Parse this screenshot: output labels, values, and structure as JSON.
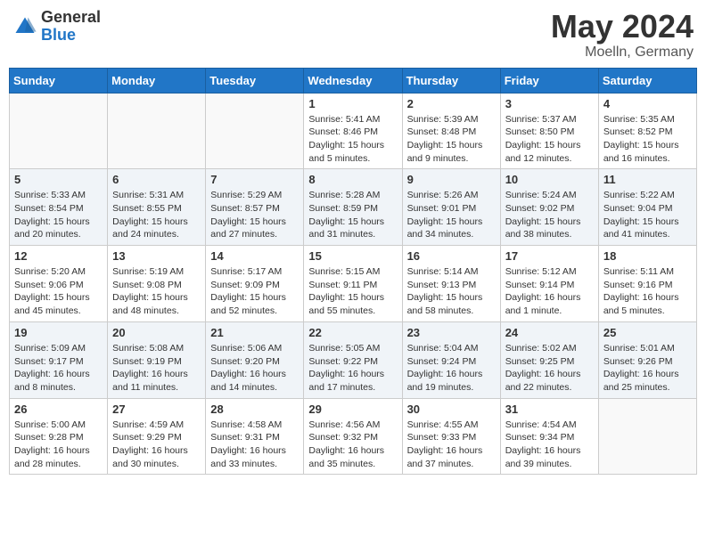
{
  "header": {
    "logo_general": "General",
    "logo_blue": "Blue",
    "title": "May 2024",
    "location": "Moelln, Germany"
  },
  "weekdays": [
    "Sunday",
    "Monday",
    "Tuesday",
    "Wednesday",
    "Thursday",
    "Friday",
    "Saturday"
  ],
  "weeks": [
    {
      "rowClass": "row-white",
      "days": [
        {
          "num": "",
          "info": "",
          "empty": true
        },
        {
          "num": "",
          "info": "",
          "empty": true
        },
        {
          "num": "",
          "info": "",
          "empty": true
        },
        {
          "num": "1",
          "info": "Sunrise: 5:41 AM\nSunset: 8:46 PM\nDaylight: 15 hours\nand 5 minutes.",
          "empty": false
        },
        {
          "num": "2",
          "info": "Sunrise: 5:39 AM\nSunset: 8:48 PM\nDaylight: 15 hours\nand 9 minutes.",
          "empty": false
        },
        {
          "num": "3",
          "info": "Sunrise: 5:37 AM\nSunset: 8:50 PM\nDaylight: 15 hours\nand 12 minutes.",
          "empty": false
        },
        {
          "num": "4",
          "info": "Sunrise: 5:35 AM\nSunset: 8:52 PM\nDaylight: 15 hours\nand 16 minutes.",
          "empty": false
        }
      ]
    },
    {
      "rowClass": "row-alt",
      "days": [
        {
          "num": "5",
          "info": "Sunrise: 5:33 AM\nSunset: 8:54 PM\nDaylight: 15 hours\nand 20 minutes.",
          "empty": false
        },
        {
          "num": "6",
          "info": "Sunrise: 5:31 AM\nSunset: 8:55 PM\nDaylight: 15 hours\nand 24 minutes.",
          "empty": false
        },
        {
          "num": "7",
          "info": "Sunrise: 5:29 AM\nSunset: 8:57 PM\nDaylight: 15 hours\nand 27 minutes.",
          "empty": false
        },
        {
          "num": "8",
          "info": "Sunrise: 5:28 AM\nSunset: 8:59 PM\nDaylight: 15 hours\nand 31 minutes.",
          "empty": false
        },
        {
          "num": "9",
          "info": "Sunrise: 5:26 AM\nSunset: 9:01 PM\nDaylight: 15 hours\nand 34 minutes.",
          "empty": false
        },
        {
          "num": "10",
          "info": "Sunrise: 5:24 AM\nSunset: 9:02 PM\nDaylight: 15 hours\nand 38 minutes.",
          "empty": false
        },
        {
          "num": "11",
          "info": "Sunrise: 5:22 AM\nSunset: 9:04 PM\nDaylight: 15 hours\nand 41 minutes.",
          "empty": false
        }
      ]
    },
    {
      "rowClass": "row-white",
      "days": [
        {
          "num": "12",
          "info": "Sunrise: 5:20 AM\nSunset: 9:06 PM\nDaylight: 15 hours\nand 45 minutes.",
          "empty": false
        },
        {
          "num": "13",
          "info": "Sunrise: 5:19 AM\nSunset: 9:08 PM\nDaylight: 15 hours\nand 48 minutes.",
          "empty": false
        },
        {
          "num": "14",
          "info": "Sunrise: 5:17 AM\nSunset: 9:09 PM\nDaylight: 15 hours\nand 52 minutes.",
          "empty": false
        },
        {
          "num": "15",
          "info": "Sunrise: 5:15 AM\nSunset: 9:11 PM\nDaylight: 15 hours\nand 55 minutes.",
          "empty": false
        },
        {
          "num": "16",
          "info": "Sunrise: 5:14 AM\nSunset: 9:13 PM\nDaylight: 15 hours\nand 58 minutes.",
          "empty": false
        },
        {
          "num": "17",
          "info": "Sunrise: 5:12 AM\nSunset: 9:14 PM\nDaylight: 16 hours\nand 1 minute.",
          "empty": false
        },
        {
          "num": "18",
          "info": "Sunrise: 5:11 AM\nSunset: 9:16 PM\nDaylight: 16 hours\nand 5 minutes.",
          "empty": false
        }
      ]
    },
    {
      "rowClass": "row-alt",
      "days": [
        {
          "num": "19",
          "info": "Sunrise: 5:09 AM\nSunset: 9:17 PM\nDaylight: 16 hours\nand 8 minutes.",
          "empty": false
        },
        {
          "num": "20",
          "info": "Sunrise: 5:08 AM\nSunset: 9:19 PM\nDaylight: 16 hours\nand 11 minutes.",
          "empty": false
        },
        {
          "num": "21",
          "info": "Sunrise: 5:06 AM\nSunset: 9:20 PM\nDaylight: 16 hours\nand 14 minutes.",
          "empty": false
        },
        {
          "num": "22",
          "info": "Sunrise: 5:05 AM\nSunset: 9:22 PM\nDaylight: 16 hours\nand 17 minutes.",
          "empty": false
        },
        {
          "num": "23",
          "info": "Sunrise: 5:04 AM\nSunset: 9:24 PM\nDaylight: 16 hours\nand 19 minutes.",
          "empty": false
        },
        {
          "num": "24",
          "info": "Sunrise: 5:02 AM\nSunset: 9:25 PM\nDaylight: 16 hours\nand 22 minutes.",
          "empty": false
        },
        {
          "num": "25",
          "info": "Sunrise: 5:01 AM\nSunset: 9:26 PM\nDaylight: 16 hours\nand 25 minutes.",
          "empty": false
        }
      ]
    },
    {
      "rowClass": "row-white",
      "days": [
        {
          "num": "26",
          "info": "Sunrise: 5:00 AM\nSunset: 9:28 PM\nDaylight: 16 hours\nand 28 minutes.",
          "empty": false
        },
        {
          "num": "27",
          "info": "Sunrise: 4:59 AM\nSunset: 9:29 PM\nDaylight: 16 hours\nand 30 minutes.",
          "empty": false
        },
        {
          "num": "28",
          "info": "Sunrise: 4:58 AM\nSunset: 9:31 PM\nDaylight: 16 hours\nand 33 minutes.",
          "empty": false
        },
        {
          "num": "29",
          "info": "Sunrise: 4:56 AM\nSunset: 9:32 PM\nDaylight: 16 hours\nand 35 minutes.",
          "empty": false
        },
        {
          "num": "30",
          "info": "Sunrise: 4:55 AM\nSunset: 9:33 PM\nDaylight: 16 hours\nand 37 minutes.",
          "empty": false
        },
        {
          "num": "31",
          "info": "Sunrise: 4:54 AM\nSunset: 9:34 PM\nDaylight: 16 hours\nand 39 minutes.",
          "empty": false
        },
        {
          "num": "",
          "info": "",
          "empty": true
        }
      ]
    }
  ]
}
